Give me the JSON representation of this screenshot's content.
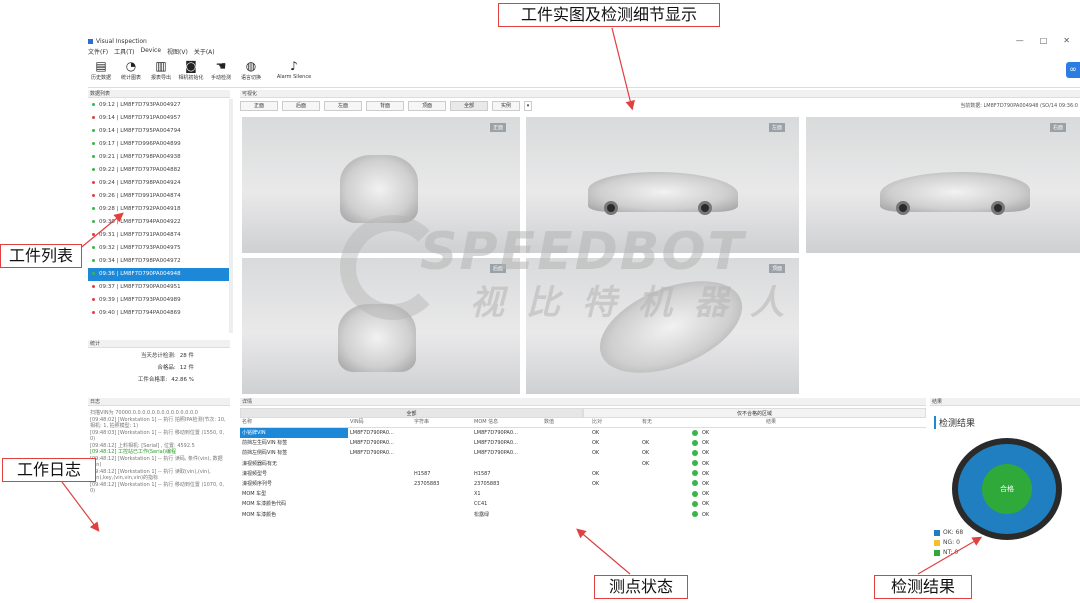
{
  "app": {
    "title": "Visual Inspection",
    "window_controls": [
      "—",
      "□",
      "✕"
    ]
  },
  "menu": [
    "文件(F)",
    "工具(T)",
    "Device",
    "视图(V)",
    "关于(A)"
  ],
  "toolbar": [
    {
      "icon": "database-icon",
      "glyph": "▤",
      "label": "历史数据"
    },
    {
      "icon": "pie-chart-icon",
      "glyph": "◔",
      "label": "统计图表"
    },
    {
      "icon": "clipboard-icon",
      "glyph": "▥",
      "label": "报表导出"
    },
    {
      "icon": "camera-icon",
      "glyph": "◙",
      "label": "相机初始化"
    },
    {
      "icon": "hand-icon",
      "glyph": "☚",
      "label": "手动检测"
    },
    {
      "icon": "globe-icon",
      "glyph": "◍",
      "label": "语言切换"
    },
    {
      "icon": "alarm-icon",
      "glyph": "♪",
      "label": "Alarm Silence"
    }
  ],
  "panels": {
    "list_title": "数据列表",
    "viz_title": "可视化",
    "stats_title": "统计",
    "log_title": "日志",
    "details_title": "详情",
    "result_title": "结果"
  },
  "workpieces": [
    {
      "text": "09:12 | LM8F7D793PA004927",
      "status": "green",
      "selected": false
    },
    {
      "text": "09:14 | LM8F7D791PA004957",
      "status": "red",
      "selected": false
    },
    {
      "text": "09:14 | LM8F7D795PA004794",
      "status": "green",
      "selected": false
    },
    {
      "text": "09:17 | LM8F7D996PA004899",
      "status": "green",
      "selected": false
    },
    {
      "text": "09:21 | LM8F7D798PA004938",
      "status": "green",
      "selected": false
    },
    {
      "text": "09:22 | LM8F7D797PA004882",
      "status": "green",
      "selected": false
    },
    {
      "text": "09:24 | LM8F7D798PA004924",
      "status": "red",
      "selected": false
    },
    {
      "text": "09:26 | LM8F7D991PA004874",
      "status": "red",
      "selected": false
    },
    {
      "text": "09:28 | LM8F7D792PA004918",
      "status": "green",
      "selected": false
    },
    {
      "text": "09:30 | LM8F7D794PA004922",
      "status": "green",
      "selected": false
    },
    {
      "text": "09:31 | LM8F7D791PA004874",
      "status": "red",
      "selected": false
    },
    {
      "text": "09:32 | LM8F7D793PA004975",
      "status": "green",
      "selected": false
    },
    {
      "text": "09:34 | LM8F7D798PA004972",
      "status": "green",
      "selected": false
    },
    {
      "text": "09:36 | LM8F7D790PA004948",
      "status": "green",
      "selected": true
    },
    {
      "text": "09:37 | LM8F7D790PA004951",
      "status": "red",
      "selected": false
    },
    {
      "text": "09:39 | LM8F7D793PA004989",
      "status": "red",
      "selected": false
    },
    {
      "text": "09:40 | LM8F7D794PA004869",
      "status": "red",
      "selected": false
    }
  ],
  "stats": [
    {
      "label": "当天总计检测:",
      "value": "28 件"
    },
    {
      "label": "合格品:",
      "value": "12 件"
    },
    {
      "label": "工件合格率:",
      "value": "42.86 %"
    }
  ],
  "log": [
    {
      "text": "扫描VIN为 70000.0.0.0.0.0.0.0.0.0.0.0.0.0.0",
      "green": false
    },
    {
      "text": "[09:48:02] [Workstation 1] -- 执行 拍照IPA检测(节次: 10, 相机: 1, 拍照模型: 1)",
      "green": false
    },
    {
      "text": "[09:48:03] [Workstation 1] -- 执行 移动到位置 (1550, 0, 0)",
      "green": false
    },
    {
      "text": "[09:48:12] 上料相机: [Serial] , 位置: 4592.5",
      "green": false
    },
    {
      "text": "[09:48:12] 工控站已工作(Serial)编程",
      "green": true
    },
    {
      "text": "[09:48:12] [Workstation 1] -- 执行 读码, 条件(vin), 数据(vin)",
      "green": false
    },
    {
      "text": "[09:48:12] [Workstation 1] -- 执行 读取(vin),(vin),(vin),key,(vin,vin,vin)的指标",
      "green": false
    },
    {
      "text": "[09:48:12] [Workstation 1] -- 执行 移动到位置 (1070, 0, 0)",
      "green": false
    }
  ],
  "views": {
    "buttons": [
      "正面",
      "后面",
      "左面",
      "背面",
      "顶面",
      "全部",
      "实例"
    ],
    "active": "全部",
    "count_label": "当前数据: LM8F7D790PA004948 (SO/14 09:36:0",
    "tags": [
      "正面",
      "左面",
      "右面",
      "后面",
      "顶面"
    ]
  },
  "watermark": {
    "en": "SPEEDBOT",
    "cn": "视比特机器人"
  },
  "details": {
    "tabs": [
      "全部",
      "仅不合格的区域"
    ],
    "columns": [
      "名称",
      "VIN码",
      "字符串",
      "MOM 信息",
      "数值",
      "比对",
      "有无",
      "",
      "结果"
    ],
    "rows": [
      {
        "name": "小铭牌VIN",
        "vin": "LM8F7D790PA0...",
        "str": "",
        "mom": "LM8F7D790PA0...",
        "num": "",
        "cmp": "OK",
        "has": "",
        "result": "OK"
      },
      {
        "name": "前挡左生码VIN 标签",
        "vin": "LM8F7D790PA0...",
        "str": "",
        "mom": "LM8F7D790PA0...",
        "num": "",
        "cmp": "OK",
        "has": "OK",
        "result": "OK"
      },
      {
        "name": "前挡左侧码VIN 标签",
        "vin": "LM8F7D790PA0...",
        "str": "",
        "mom": "LM8F7D790PA0...",
        "num": "",
        "cmp": "OK",
        "has": "OK",
        "result": "OK"
      },
      {
        "name": "濠视频器码有无",
        "vin": "",
        "str": "",
        "mom": "",
        "num": "",
        "cmp": "",
        "has": "OK",
        "result": "OK"
      },
      {
        "name": "濠视频型号",
        "vin": "",
        "str": "H1587",
        "mom": "H1587",
        "num": "",
        "cmp": "OK",
        "has": "",
        "result": "OK"
      },
      {
        "name": "濠视频序列号",
        "vin": "",
        "str": "23705883",
        "mom": "23705883",
        "num": "",
        "cmp": "OK",
        "has": "",
        "result": "OK"
      },
      {
        "name": "MOM 车型",
        "vin": "",
        "str": "",
        "mom": "X1",
        "num": "",
        "cmp": "",
        "has": "",
        "result": "OK"
      },
      {
        "name": "MOM 车漆颜色代码",
        "vin": "",
        "str": "",
        "mom": "CC41",
        "num": "",
        "cmp": "",
        "has": "",
        "result": "OK"
      },
      {
        "name": "MOM 车漆颜色",
        "vin": "",
        "str": "",
        "mom": "松露绿",
        "num": "",
        "cmp": "",
        "has": "",
        "result": "OK"
      }
    ]
  },
  "result": {
    "title": "检测结果",
    "center": "合格",
    "legend": [
      {
        "label": "OK: 68",
        "color": "#1f7fc0"
      },
      {
        "label": "NG: 0",
        "color": "#f2c12e"
      },
      {
        "label": "NT: 0",
        "color": "#2faa3a"
      }
    ]
  },
  "callouts": {
    "top": "工件实图及检测细节显示",
    "list": "工件列表",
    "log": "工作日志",
    "points": "测点状态",
    "result": "检测结果"
  },
  "colors": {
    "accent": "#1e88d8",
    "ok": "#39b54a",
    "ng": "#e04040",
    "callout_border": "#e04040"
  }
}
